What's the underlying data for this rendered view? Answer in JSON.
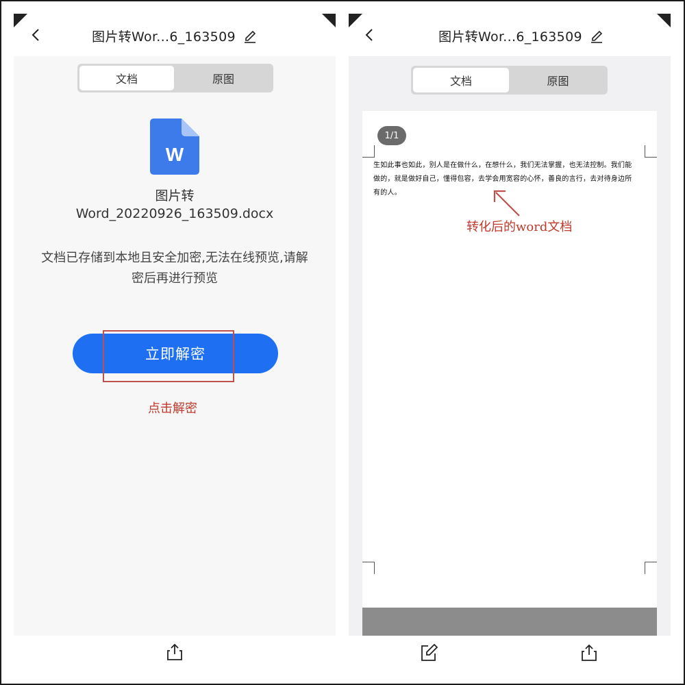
{
  "left": {
    "header": {
      "title": "图片转Wor...6_163509"
    },
    "segment": {
      "tab_doc": "文档",
      "tab_original": "原图",
      "active": "文档"
    },
    "file": {
      "icon_letter": "W",
      "name_line1": "图片转",
      "name_line2": "Word_20220926_163509.docx"
    },
    "notice": {
      "line1": "文档已存储到本地且安全加密,无法在线预览,请解",
      "line2": "密后再进行预览"
    },
    "decrypt_button": "立即解密",
    "annotation": "点击解密"
  },
  "right": {
    "header": {
      "title": "图片转Wor...6_163509"
    },
    "segment": {
      "tab_doc": "文档",
      "tab_original": "原图",
      "active": "文档"
    },
    "page_indicator": "1/1",
    "doc_text": {
      "line1": "生如此事也如此，别人是在做什么，在想什么，我们无法掌握，也无法控制。我们能",
      "line2": "做的，就是做好自己，懂得包容，去学会用宽容的心怀，善良的言行，去对待身边所",
      "line3": "有的人。"
    },
    "annotation": "转化后的word文档"
  },
  "colors": {
    "accent_blue": "#1e6ff2",
    "annotation_red": "#c0392b",
    "word_icon_blue": "#3e7bea"
  }
}
